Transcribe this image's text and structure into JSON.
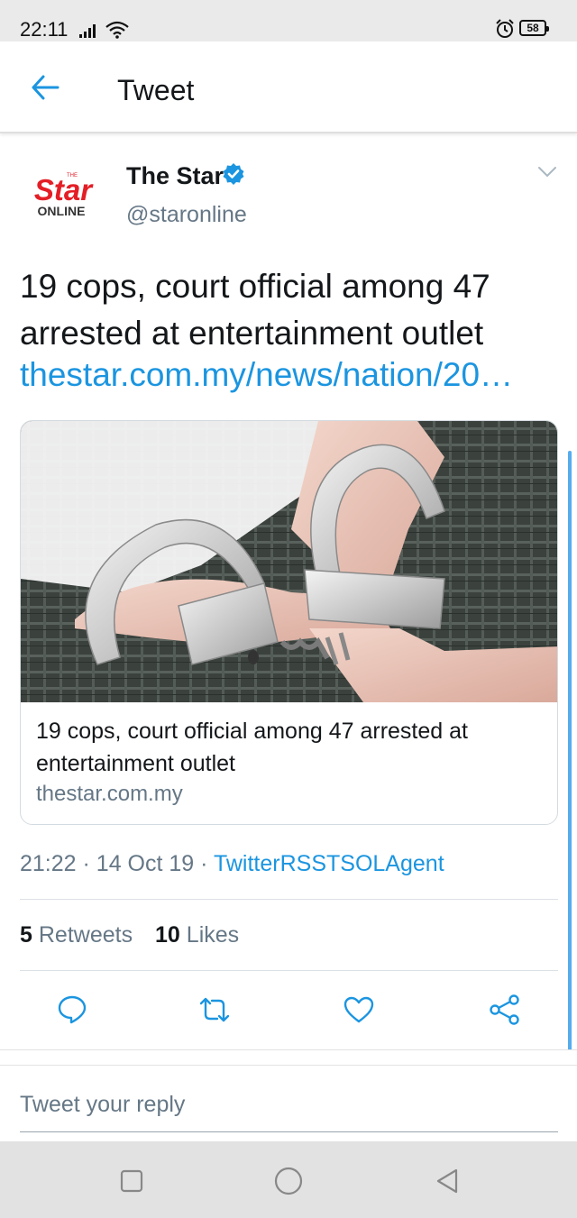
{
  "status_bar": {
    "time": "22:11",
    "battery": "58",
    "icons": [
      "signal-icon",
      "wifi-icon",
      "alarm-icon",
      "battery-icon"
    ]
  },
  "header": {
    "title": "Tweet",
    "back_icon": "arrow-left-icon"
  },
  "tweet": {
    "author_name": "The Star",
    "author_handle": "@staronline",
    "avatar_logo": {
      "top": "THE",
      "main": "Star",
      "bottom": "ONLINE"
    },
    "text": "19 cops, court official among 47 arrested at entertainment outlet",
    "link": "thestar.com.my/news/nation/20…",
    "card": {
      "image_description": "handcuffs",
      "title": "19 cops, court official among 47 arrested at entertainment outlet",
      "domain": "thestar.com.my"
    },
    "time": "21:22",
    "date": "14 Oct 19",
    "source": "TwitterRSSTSOLAgent",
    "separator": "·",
    "retweets_count": "5",
    "retweets_label": "Retweets",
    "likes_count": "10",
    "likes_label": "Likes"
  },
  "actions": [
    "reply-icon",
    "retweet-icon",
    "like-icon",
    "share-icon"
  ],
  "reply": {
    "placeholder": "Tweet your reply"
  },
  "nav": [
    "recent-apps-icon",
    "home-icon",
    "back-icon"
  ],
  "colors": {
    "accent": "#1b95e0",
    "text": "#14171a",
    "secondary_text": "#657786",
    "logo_red": "#e41e26"
  }
}
